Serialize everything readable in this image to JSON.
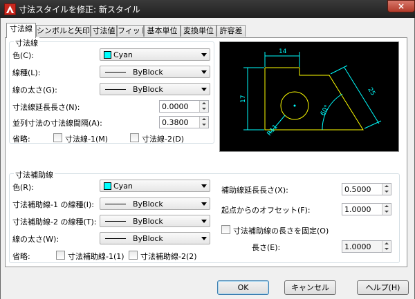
{
  "window": {
    "title": "寸法スタイルを修正: 新スタイル",
    "close_glyph": "×"
  },
  "tabs": [
    "寸法線",
    "シンボルと矢印",
    "寸法値",
    "フィット",
    "基本単位",
    "変換単位",
    "許容差"
  ],
  "dim_lines": {
    "group_label": "寸法線",
    "color_label": "色(C):",
    "color_value": "Cyan",
    "linetype_label": "線種(L):",
    "linetype_value": "ByBlock",
    "lineweight_label": "線の太さ(G):",
    "lineweight_value": "ByBlock",
    "extend_label": "寸法線延長長さ(N):",
    "extend_value": "0.0000",
    "baseline_label": "並列寸法の寸法線間隔(A):",
    "baseline_value": "0.3800",
    "suppress_label": "省略:",
    "suppress1_label": "寸法線-1(M)",
    "suppress2_label": "寸法線-2(D)"
  },
  "ext_lines": {
    "group_label": "寸法補助線",
    "color_label": "色(R):",
    "color_value": "Cyan",
    "linetype1_label": "寸法補助線-1 の線種(I):",
    "linetype1_value": "ByBlock",
    "linetype2_label": "寸法補助線-2 の線種(T):",
    "linetype2_value": "ByBlock",
    "lineweight_label": "線の太さ(W):",
    "lineweight_value": "ByBlock",
    "suppress_label": "省略:",
    "suppress1_label": "寸法補助線-1(1)",
    "suppress2_label": "寸法補助線-2(2)",
    "extend_label": "補助線延長長さ(X):",
    "extend_value": "0.5000",
    "offset_label": "起点からのオフセット(F):",
    "offset_value": "1.0000",
    "fixed_label": "寸法補助線の長さを固定(O)",
    "length_label": "長さ(E):",
    "length_value": "1.0000"
  },
  "preview": {
    "dim_top": "14",
    "dim_left": "17",
    "dim_slant": "25",
    "dim_angle": "60°",
    "dim_radius": "R11"
  },
  "buttons": {
    "ok": "OK",
    "cancel": "キャンセル",
    "help": "ヘルプ(H)"
  },
  "colors": {
    "cyan_swatch": "#00ffff",
    "preview_bg": "#000000",
    "preview_geometry": "#ffff00",
    "preview_dims": "#00ffff"
  }
}
